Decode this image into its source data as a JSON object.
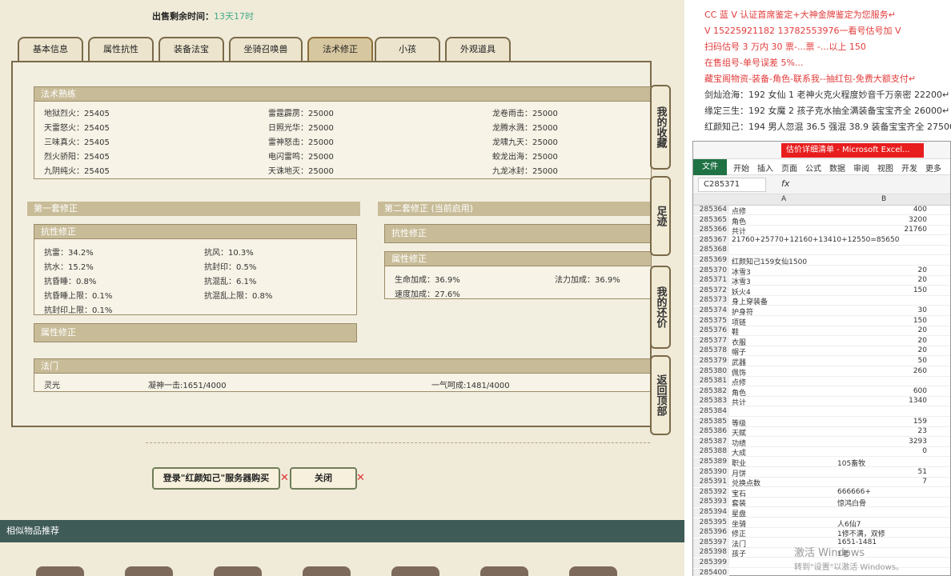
{
  "sale": {
    "label": "出售剩余时间：",
    "value": "13天17时"
  },
  "tabs": [
    {
      "label": "基本信息"
    },
    {
      "label": "属性抗性"
    },
    {
      "label": "装备法宝"
    },
    {
      "label": "坐骑召唤兽"
    },
    {
      "label": "法术修正"
    },
    {
      "label": "小孩"
    },
    {
      "label": "外观道具"
    }
  ],
  "fashu": {
    "title": "法术熟练",
    "rows": [
      [
        "地狱烈火：25405",
        "雷霆霹雳：25000",
        "龙卷雨击：25000"
      ],
      [
        "天雷怒火：25405",
        "日照光华：25000",
        "龙腾水溅：25000"
      ],
      [
        "三味真火：25405",
        "雷神怒击：25000",
        "龙啸九天：25000"
      ],
      [
        "烈火骄阳：25405",
        "电闪雷鸣：25000",
        "蛟龙出海：25000"
      ],
      [
        "九阴纯火：25405",
        "天诛地灭：25000",
        "九龙冰封：25000"
      ]
    ]
  },
  "set1": {
    "title": "第一套修正"
  },
  "set2": {
    "title": "第二套修正 (当前启用)"
  },
  "kx1": {
    "title": "抗性修正",
    "rows": [
      [
        "抗雷：34.2%",
        "抗风：10.3%"
      ],
      [
        "抗水：15.2%",
        "抗封印：0.5%"
      ],
      [
        "抗昏睡：0.8%",
        "抗混乱：6.1%"
      ],
      [
        "抗昏睡上限：0.1%",
        "抗混乱上限：0.8%"
      ],
      [
        "抗封印上限：0.1%",
        ""
      ]
    ]
  },
  "sx1": {
    "title": "属性修正"
  },
  "kx2": {
    "title": "抗性修正"
  },
  "sx2": {
    "title": "属性修正",
    "rows": [
      [
        "生命加成：36.9%",
        "法力加成：36.9%"
      ],
      [
        "速度加成：27.6%",
        ""
      ]
    ]
  },
  "famen": {
    "title": "法门",
    "items": [
      "灵光",
      "凝神一击:1651/4000",
      "一气呵成:1481/4000"
    ]
  },
  "side": [
    "我的收藏",
    "足迹",
    "我的还价",
    "返回顶部"
  ],
  "buttons": {
    "login": "登录\"红颜知己\"服务器购买",
    "close": "关闭"
  },
  "similar": "相似物品推荐",
  "right": {
    "lines": [
      {
        "text": "CC 蓝 V 认证首席鉴定+大神金牌鉴定为您服务↵",
        "color": "#e23b3b"
      },
      {
        "text": "V 15225921182    13782553976一看号估号加 V",
        "color": "#e23b3b"
      },
      {
        "text": "扫码估号 3 万内 30 票-...票 -...以上 150",
        "color": "#e23b3b"
      },
      {
        "text": "在售组号-单号误差 5%...",
        "color": "#e23b3b"
      },
      {
        "text": "藏宝阁物资-装备-角色-联系我--抽红包-免费大额支付↵",
        "color": "#e23b3b"
      },
      {
        "text": "剑灿沧海：192 女仙 1 老神火克火程度妙音千万亲密 22200↵",
        "color": "#333"
      },
      {
        "text": "缘定三生：192 女魔 2 孩子克水抽全满装备宝宝齐全 26000↵",
        "color": "#333"
      },
      {
        "text": "红颜知己：194 男人忽混 36.5 强混 38.9 装备宝宝齐全 27500↵",
        "color": "#333"
      }
    ]
  },
  "excel": {
    "title": "估价详细清单 - Microsoft Excel...",
    "ribbon": [
      "文件",
      "开始",
      "插入",
      "页面",
      "公式",
      "数据",
      "审阅",
      "视图",
      "开发",
      "更多"
    ],
    "namebox": "C285371",
    "fx": "fx",
    "colA": "A",
    "colB": "B",
    "rows": [
      [
        "285364",
        "点修",
        "400"
      ],
      [
        "285365",
        "角色",
        "3200"
      ],
      [
        "285366",
        "共计",
        "21760"
      ],
      [
        "285367",
        "21760+25770+12160+13410+12550=85650",
        ""
      ],
      [
        "285368",
        "",
        ""
      ],
      [
        "285369",
        "红颜知己159女仙1500",
        ""
      ],
      [
        "285370",
        "冰雪3",
        "20"
      ],
      [
        "285371",
        "冰雪3",
        "20"
      ],
      [
        "285372",
        "妖火4",
        "150"
      ],
      [
        "285373",
        "身上穿装备",
        ""
      ],
      [
        "285374",
        "护身符",
        "30"
      ],
      [
        "285375",
        "项链",
        "150"
      ],
      [
        "285376",
        "鞋",
        "20"
      ],
      [
        "285377",
        "衣服",
        "20"
      ],
      [
        "285378",
        "帽子",
        "20"
      ],
      [
        "285379",
        "武器",
        "50"
      ],
      [
        "285380",
        "佩饰",
        "260"
      ],
      [
        "285381",
        "点修",
        ""
      ],
      [
        "285382",
        "角色",
        "600"
      ],
      [
        "285383",
        "共计",
        "1340"
      ],
      [
        "285384",
        "",
        ""
      ],
      [
        "285385",
        "等级",
        "159"
      ],
      [
        "285386",
        "天赋",
        "23"
      ],
      [
        "285387",
        "功绩",
        "3293"
      ],
      [
        "285388",
        "大成",
        "0"
      ],
      [
        "285389",
        "职业",
        "105畜牧"
      ],
      [
        "285390",
        "月饼",
        "51"
      ],
      [
        "285391",
        "兑换点数",
        "7"
      ],
      [
        "285392",
        "宝石",
        "666666+"
      ],
      [
        "285393",
        "套装",
        "惊鸿白骨"
      ],
      [
        "285394",
        "星盘",
        ""
      ],
      [
        "285395",
        "坐骑",
        "人6仙7"
      ],
      [
        "285396",
        "修正",
        "1修不满，双修"
      ],
      [
        "285397",
        "法门",
        "1651-1481"
      ],
      [
        "285398",
        "孩子",
        "1老"
      ],
      [
        "285399",
        "",
        ""
      ],
      [
        "285400",
        "",
        ""
      ]
    ],
    "watermark": "激活 Windows",
    "watermark2": "转到\"设置\"以激活 Windows。"
  }
}
